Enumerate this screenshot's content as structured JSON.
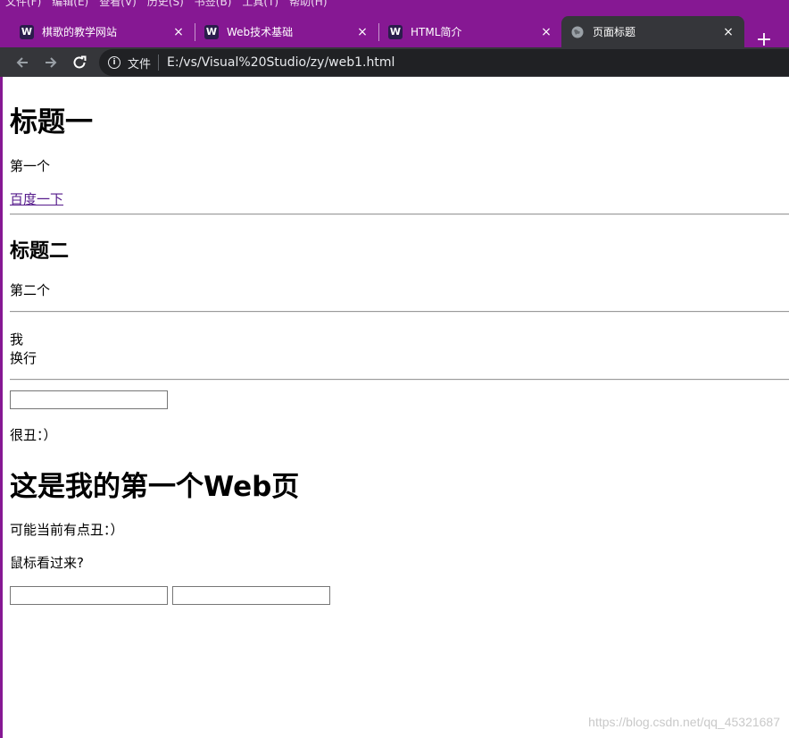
{
  "browser": {
    "menu_items": [
      "文件(F)",
      "编辑(E)",
      "查看(V)",
      "历史(S)",
      "书签(B)",
      "工具(T)",
      "帮助(H)"
    ],
    "tabs": [
      {
        "title": "棋歌的教学网站",
        "favicon": "W"
      },
      {
        "title": "Web技术基础",
        "favicon": "W"
      },
      {
        "title": "HTML简介",
        "favicon": "W"
      },
      {
        "title": "页面标题",
        "favicon": "globe-icon",
        "active": true
      }
    ],
    "close_glyph": "×",
    "new_tab_glyph": "+",
    "nav": {
      "back": "←",
      "forward": "→",
      "reload": "↻"
    },
    "address": {
      "info_glyph": "i",
      "scheme_label": "文件",
      "url": "E:/vs/Visual%20Studio/zy/web1.html"
    },
    "theme_color": "#861893",
    "toolbar_color": "#35363a"
  },
  "page": {
    "heading1": "标题一",
    "para1": "第一个",
    "link": "百度一下",
    "heading2": "标题二",
    "para2": "第二个",
    "line_a": "我",
    "line_b": "换行",
    "para_ugly": "很丑：）",
    "heading3": "这是我的第一个Web页",
    "para_maybe": "可能当前有点丑：）",
    "para_mouse": "鼠标看过来?",
    "input1_value": "",
    "input2_value": "",
    "input3_value": ""
  },
  "watermark": "https://blog.csdn.net/qq_45321687"
}
